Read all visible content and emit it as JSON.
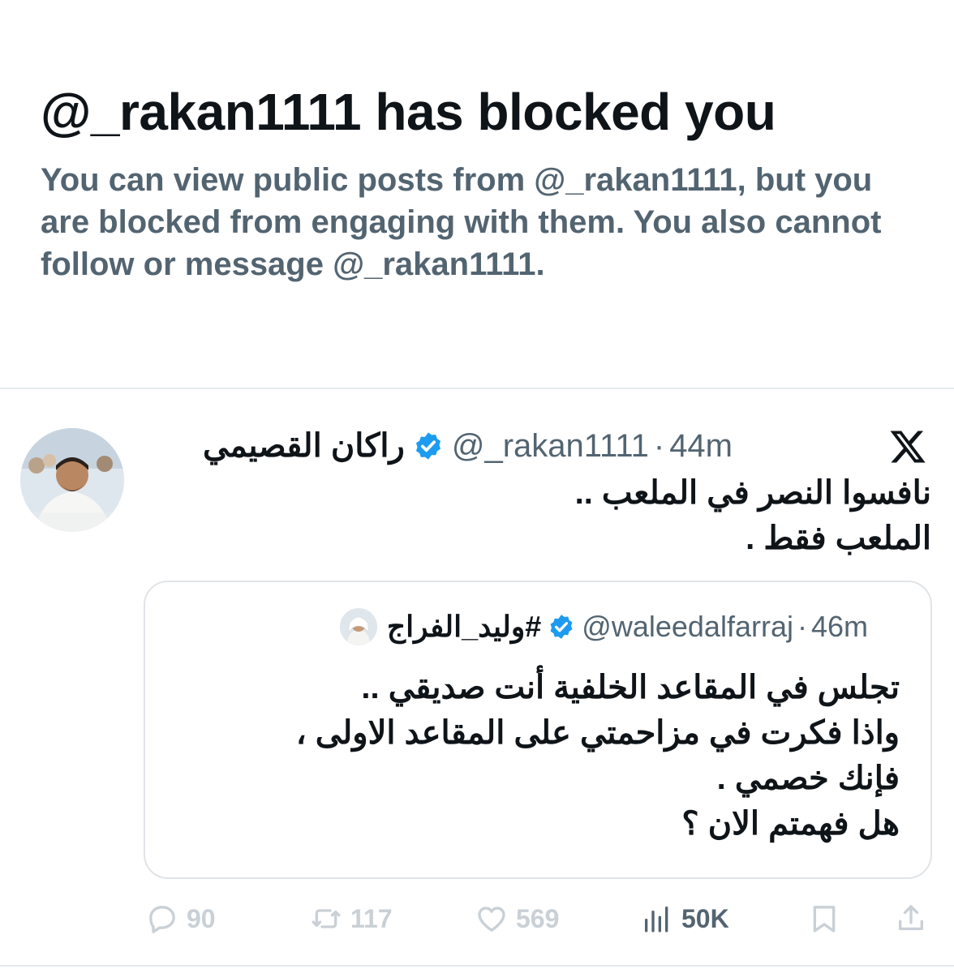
{
  "blocked": {
    "title": "@_rakan1111 has blocked you",
    "description": "You can view public posts from @_rakan1111, but you are blocked from engaging with them. You also cannot follow or message @_rakan1111."
  },
  "post": {
    "author_name": "راكان القصيمي",
    "handle": "@_rakan1111",
    "separator": "·",
    "time": "44m",
    "body_lines": [
      "نافسوا النصر في الملعب ..",
      "الملعب فقط ."
    ]
  },
  "quote": {
    "author_name": "#وليد_الفراج",
    "handle": "@waleedalfarraj",
    "separator": "·",
    "time": "46m",
    "body_lines": [
      "تجلس في المقاعد الخلفية أنت صديقي ..",
      "واذا فكرت في مزاحمتي على المقاعد الاولى ،",
      "فإنك خصمي .",
      "هل فهمتم الان ؟"
    ]
  },
  "actions": {
    "replies": "90",
    "reposts": "117",
    "likes": "569",
    "views": "50K"
  },
  "icons": {
    "verified": "verified-badge-icon",
    "brand": "x-logo-icon",
    "reply": "reply-icon",
    "repost": "repost-icon",
    "like": "heart-icon",
    "views": "views-chart-icon",
    "bookmark": "bookmark-icon",
    "share": "share-icon"
  },
  "colors": {
    "text_primary": "#0f1419",
    "text_secondary": "#536471",
    "verified_blue": "#1d9bf0",
    "disabled_action": "#c9d0d6",
    "border": "#e6e9eb"
  }
}
